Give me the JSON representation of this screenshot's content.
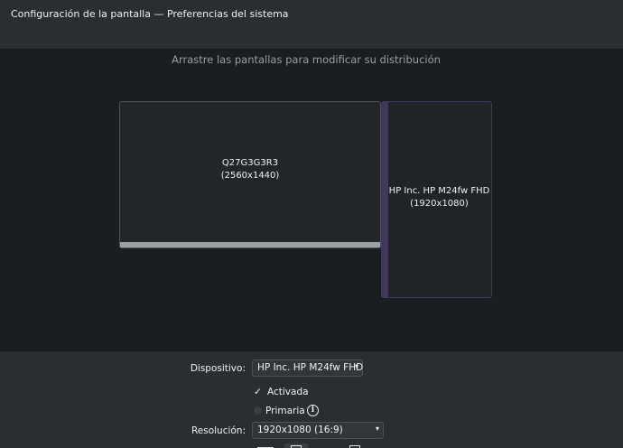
{
  "window": {
    "title": "Configuración de la pantalla — Preferencias del sistema"
  },
  "arrangement": {
    "hint": "Arrastre las pantallas para modificar su distribución",
    "screens": [
      {
        "name": "Q27G3G3R3",
        "resolution": "(2560x1440)",
        "selected": false
      },
      {
        "name": "HP Inc. HP M24fw FHD",
        "resolution": "(1920x1080)",
        "selected": true
      }
    ]
  },
  "settings": {
    "device_label": "Dispositivo:",
    "device_value": "HP Inc. HP M24fw FHD",
    "enabled_label": "Activada",
    "enabled_checked": true,
    "primary_label": "Primaria",
    "primary_checked": false,
    "resolution_label": "Resolución:",
    "resolution_value": "1920x1080 (16:9)",
    "info_icon": "i"
  },
  "icons": {
    "check": "✓",
    "dropdown": "▾"
  }
}
